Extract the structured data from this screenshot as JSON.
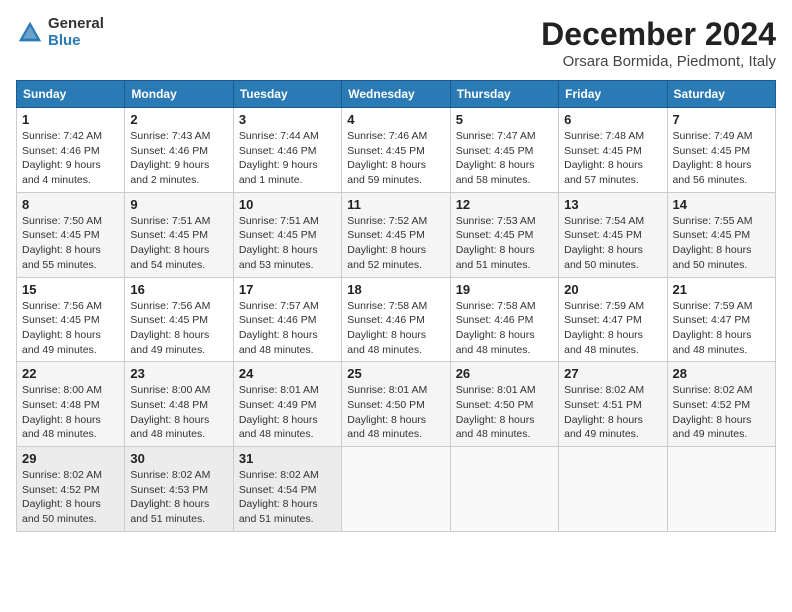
{
  "logo": {
    "general": "General",
    "blue": "Blue"
  },
  "header": {
    "month": "December 2024",
    "location": "Orsara Bormida, Piedmont, Italy"
  },
  "weekdays": [
    "Sunday",
    "Monday",
    "Tuesday",
    "Wednesday",
    "Thursday",
    "Friday",
    "Saturday"
  ],
  "weeks": [
    [
      {
        "day": 1,
        "sunrise": "7:42 AM",
        "sunset": "4:46 PM",
        "daylight": "9 hours and 4 minutes."
      },
      {
        "day": 2,
        "sunrise": "7:43 AM",
        "sunset": "4:46 PM",
        "daylight": "9 hours and 2 minutes."
      },
      {
        "day": 3,
        "sunrise": "7:44 AM",
        "sunset": "4:46 PM",
        "daylight": "9 hours and 1 minute."
      },
      {
        "day": 4,
        "sunrise": "7:46 AM",
        "sunset": "4:45 PM",
        "daylight": "8 hours and 59 minutes."
      },
      {
        "day": 5,
        "sunrise": "7:47 AM",
        "sunset": "4:45 PM",
        "daylight": "8 hours and 58 minutes."
      },
      {
        "day": 6,
        "sunrise": "7:48 AM",
        "sunset": "4:45 PM",
        "daylight": "8 hours and 57 minutes."
      },
      {
        "day": 7,
        "sunrise": "7:49 AM",
        "sunset": "4:45 PM",
        "daylight": "8 hours and 56 minutes."
      }
    ],
    [
      {
        "day": 8,
        "sunrise": "7:50 AM",
        "sunset": "4:45 PM",
        "daylight": "8 hours and 55 minutes."
      },
      {
        "day": 9,
        "sunrise": "7:51 AM",
        "sunset": "4:45 PM",
        "daylight": "8 hours and 54 minutes."
      },
      {
        "day": 10,
        "sunrise": "7:51 AM",
        "sunset": "4:45 PM",
        "daylight": "8 hours and 53 minutes."
      },
      {
        "day": 11,
        "sunrise": "7:52 AM",
        "sunset": "4:45 PM",
        "daylight": "8 hours and 52 minutes."
      },
      {
        "day": 12,
        "sunrise": "7:53 AM",
        "sunset": "4:45 PM",
        "daylight": "8 hours and 51 minutes."
      },
      {
        "day": 13,
        "sunrise": "7:54 AM",
        "sunset": "4:45 PM",
        "daylight": "8 hours and 50 minutes."
      },
      {
        "day": 14,
        "sunrise": "7:55 AM",
        "sunset": "4:45 PM",
        "daylight": "8 hours and 50 minutes."
      }
    ],
    [
      {
        "day": 15,
        "sunrise": "7:56 AM",
        "sunset": "4:45 PM",
        "daylight": "8 hours and 49 minutes."
      },
      {
        "day": 16,
        "sunrise": "7:56 AM",
        "sunset": "4:45 PM",
        "daylight": "8 hours and 49 minutes."
      },
      {
        "day": 17,
        "sunrise": "7:57 AM",
        "sunset": "4:46 PM",
        "daylight": "8 hours and 48 minutes."
      },
      {
        "day": 18,
        "sunrise": "7:58 AM",
        "sunset": "4:46 PM",
        "daylight": "8 hours and 48 minutes."
      },
      {
        "day": 19,
        "sunrise": "7:58 AM",
        "sunset": "4:46 PM",
        "daylight": "8 hours and 48 minutes."
      },
      {
        "day": 20,
        "sunrise": "7:59 AM",
        "sunset": "4:47 PM",
        "daylight": "8 hours and 48 minutes."
      },
      {
        "day": 21,
        "sunrise": "7:59 AM",
        "sunset": "4:47 PM",
        "daylight": "8 hours and 48 minutes."
      }
    ],
    [
      {
        "day": 22,
        "sunrise": "8:00 AM",
        "sunset": "4:48 PM",
        "daylight": "8 hours and 48 minutes."
      },
      {
        "day": 23,
        "sunrise": "8:00 AM",
        "sunset": "4:48 PM",
        "daylight": "8 hours and 48 minutes."
      },
      {
        "day": 24,
        "sunrise": "8:01 AM",
        "sunset": "4:49 PM",
        "daylight": "8 hours and 48 minutes."
      },
      {
        "day": 25,
        "sunrise": "8:01 AM",
        "sunset": "4:50 PM",
        "daylight": "8 hours and 48 minutes."
      },
      {
        "day": 26,
        "sunrise": "8:01 AM",
        "sunset": "4:50 PM",
        "daylight": "8 hours and 48 minutes."
      },
      {
        "day": 27,
        "sunrise": "8:02 AM",
        "sunset": "4:51 PM",
        "daylight": "8 hours and 49 minutes."
      },
      {
        "day": 28,
        "sunrise": "8:02 AM",
        "sunset": "4:52 PM",
        "daylight": "8 hours and 49 minutes."
      }
    ],
    [
      {
        "day": 29,
        "sunrise": "8:02 AM",
        "sunset": "4:52 PM",
        "daylight": "8 hours and 50 minutes."
      },
      {
        "day": 30,
        "sunrise": "8:02 AM",
        "sunset": "4:53 PM",
        "daylight": "8 hours and 51 minutes."
      },
      {
        "day": 31,
        "sunrise": "8:02 AM",
        "sunset": "4:54 PM",
        "daylight": "8 hours and 51 minutes."
      },
      null,
      null,
      null,
      null
    ]
  ]
}
